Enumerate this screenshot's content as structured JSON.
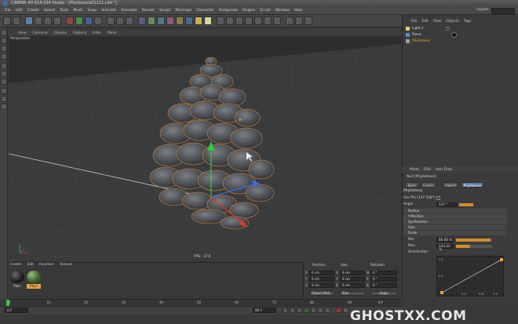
{
  "window": {
    "title": "CINEMA 4D R14.034 Studio - [Phyllotaxis01111.c4d *]"
  },
  "menubar": {
    "items": [
      "File",
      "Edit",
      "Create",
      "Select",
      "Tools",
      "Mesh",
      "Snap",
      "Animate",
      "Simulate",
      "Render",
      "Sculpt",
      "MoGraph",
      "Character",
      "AixSponza",
      "Plugins",
      "Script",
      "Window",
      "Help"
    ]
  },
  "layout": {
    "label": "Layout:"
  },
  "viewport": {
    "menu": [
      "View",
      "Cameras",
      "Display",
      "Options",
      "Filter",
      "Panel"
    ],
    "label": "Perspective",
    "fps": "FPS : 37.6"
  },
  "object_manager": {
    "menu": [
      "File",
      "Edit",
      "View",
      "Objects",
      "Tags"
    ],
    "objects": [
      {
        "name": "Light.1",
        "icon": "light-icon"
      },
      {
        "name": "Plane",
        "icon": "plane-icon"
      },
      {
        "name": "Phyllotaxis",
        "icon": "null-icon"
      }
    ]
  },
  "attribute_manager": {
    "menu": [
      "Mode",
      "Edit",
      "User Data"
    ],
    "title": "Null [Phyllotaxis]",
    "tabs": [
      "Basic",
      "Coord.",
      "Object",
      "Phyllotaxis"
    ],
    "section": "Phyllotaxis",
    "use_phi_label": "Use Phi (137.508°)",
    "angle_label": "Angle",
    "angle_value": "137 °",
    "groups": [
      "Radius",
      "Y-Position",
      "Up-Rotation",
      "Size"
    ],
    "scale_group": "Scale",
    "min_label": "Min",
    "min_value": "66.06 %",
    "max_label": "Max",
    "max_value": "133.22 %",
    "distribution_label": "Distribution",
    "curve_ticks_y": [
      "1.0",
      "0.5"
    ],
    "curve_ticks_x": [
      "0.5",
      "0.8",
      "1.0"
    ]
  },
  "material_manager": {
    "menu": [
      "Create",
      "Edit",
      "Function",
      "Texture"
    ],
    "materials": [
      {
        "name": "Plain",
        "color": "#1b1b1b"
      },
      {
        "name": "Phyll",
        "color": "#3b5a2c"
      }
    ]
  },
  "coordinates": {
    "headers": [
      "Position",
      "Size",
      "Rotation"
    ],
    "axes_pos": [
      "X",
      "Y",
      "Z"
    ],
    "axes_rot": [
      "H",
      "P",
      "B"
    ],
    "position": [
      "0 cm",
      "0 cm",
      "0 cm"
    ],
    "size": [
      "0 cm",
      "0 cm",
      "0 cm"
    ],
    "rotation": [
      "0 °",
      "0 °",
      "0 °"
    ],
    "mode": "Object (Rel)",
    "size_mode": "Size",
    "apply": "Apply"
  },
  "timeline": {
    "ticks": [
      "0",
      "10",
      "20",
      "30",
      "40",
      "50",
      "60",
      "70",
      "80",
      "90"
    ],
    "frame_start": "0 F",
    "frame_end": "90 F",
    "current_frame": "0 F"
  },
  "watermark": "GHOSTXX.COM",
  "colors": {
    "accent": "#5577a0",
    "selection": "#e8a240",
    "playhead": "#39c64a"
  }
}
